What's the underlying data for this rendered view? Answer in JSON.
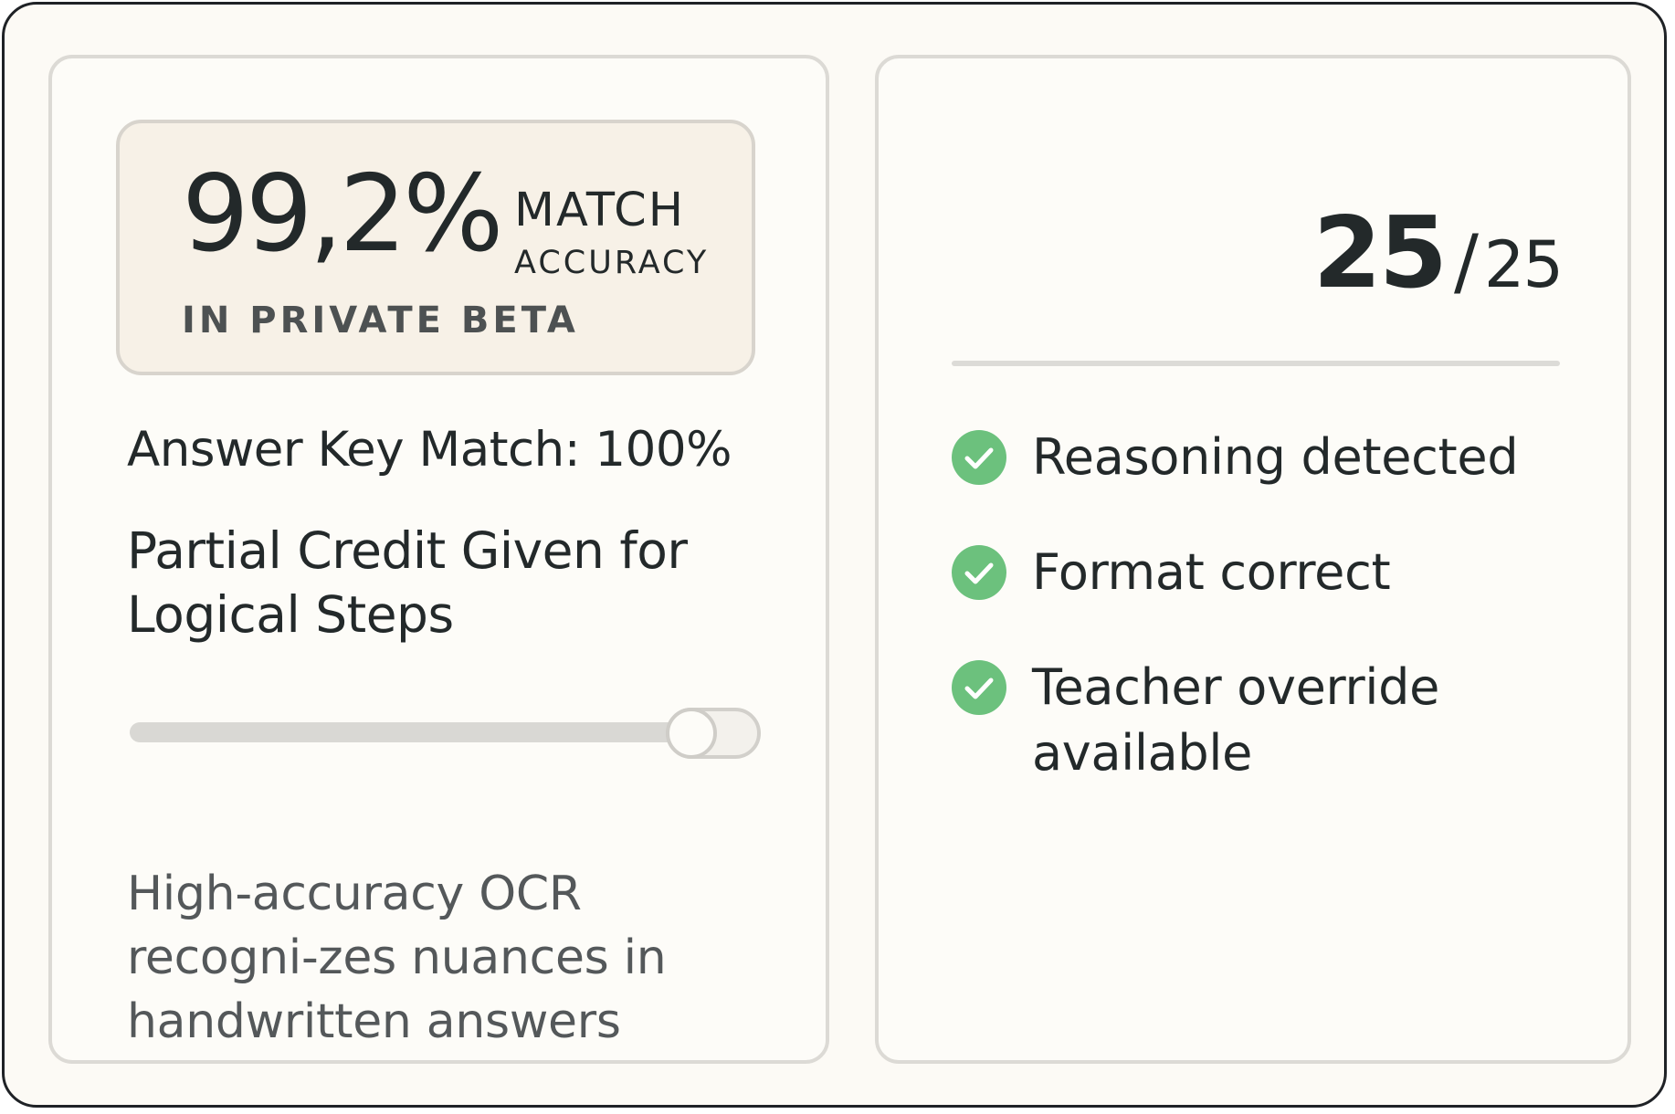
{
  "accuracy_card": {
    "percent": "99,2%",
    "match_label": "MATCH",
    "accuracy_label": "ACCURACY",
    "beta_label": "IN PRIVATE BETA"
  },
  "answer_key_match": "Answer Key Match: 100%",
  "partial_credit": "Partial Credit Given for Logical Steps",
  "slider": {
    "level": 1.0
  },
  "ocr_description": "High-accuracy OCR recogni-zes nuances in handwritten answers",
  "score": {
    "value": "25",
    "separator": "/",
    "total": "25"
  },
  "checks": [
    {
      "label": "Reasoning detected",
      "icon": "check-circle-icon"
    },
    {
      "label": "Format correct",
      "icon": "check-circle-icon"
    },
    {
      "label": "Teacher override available",
      "icon": "check-circle-icon"
    }
  ],
  "colors": {
    "check_green": "#6cc17d",
    "text_dark": "#23292a",
    "background": "#fcfaf5",
    "accent_box": "#f7f1e7"
  }
}
